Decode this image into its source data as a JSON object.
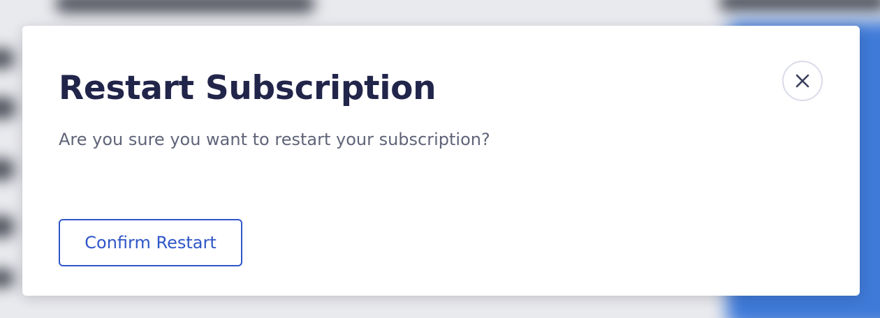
{
  "modal": {
    "title": "Restart Subscription",
    "message": "Are you sure you want to restart your subscription?",
    "confirm_label": "Confirm Restart",
    "close_icon": "close-icon"
  },
  "colors": {
    "title": "#22254a",
    "message": "#5f6478",
    "accent": "#2f56c7",
    "close_border": "#d9dbe9",
    "background_blur_blue": "#3f7ad8"
  }
}
